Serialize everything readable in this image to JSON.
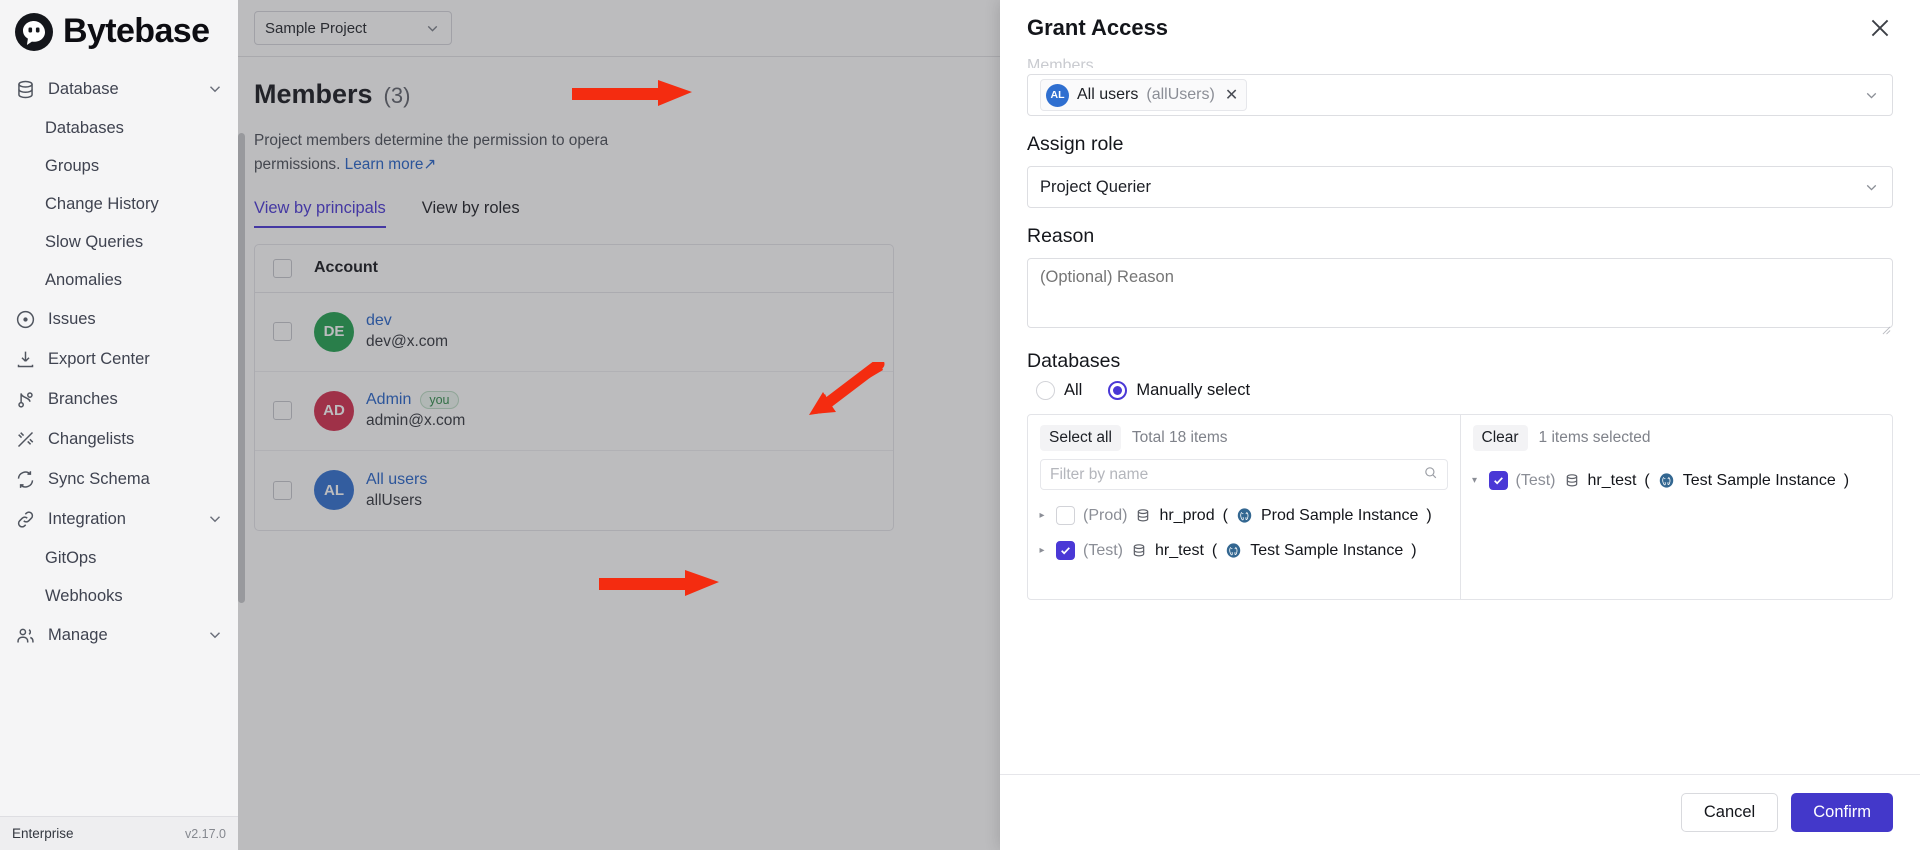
{
  "sidebar": {
    "brand": "Bytebase",
    "items": [
      {
        "label": "Database",
        "icon": "database-icon",
        "expandable": true
      },
      {
        "label": "Databases",
        "sub": true
      },
      {
        "label": "Groups",
        "sub": true
      },
      {
        "label": "Change History",
        "sub": true
      },
      {
        "label": "Slow Queries",
        "sub": true
      },
      {
        "label": "Anomalies",
        "sub": true
      },
      {
        "label": "Issues",
        "icon": "circle-dot-icon",
        "expandable": false
      },
      {
        "label": "Export Center",
        "icon": "download-icon",
        "expandable": false
      },
      {
        "label": "Branches",
        "icon": "branch-icon",
        "expandable": false
      },
      {
        "label": "Changelists",
        "icon": "changelist-icon",
        "expandable": false
      },
      {
        "label": "Sync Schema",
        "icon": "sync-icon",
        "expandable": false
      },
      {
        "label": "Integration",
        "icon": "link-icon",
        "expandable": true
      },
      {
        "label": "GitOps",
        "sub": true
      },
      {
        "label": "Webhooks",
        "sub": true
      },
      {
        "label": "Manage",
        "icon": "users-icon",
        "expandable": true
      }
    ],
    "footer": {
      "plan": "Enterprise",
      "version": "v2.17.0"
    }
  },
  "topbar": {
    "project": "Sample Project"
  },
  "page": {
    "title": "Members",
    "count": "(3)",
    "description": "Project members determine the permission to opera",
    "description2": "permissions.",
    "learn_more": "Learn more",
    "tabs": [
      {
        "label": "View by principals",
        "active": true
      },
      {
        "label": "View by roles",
        "active": false
      }
    ],
    "table": {
      "columns": [
        "Account"
      ],
      "rows": [
        {
          "initials": "DE",
          "color": "#21a150",
          "name": "dev",
          "email": "dev@x.com",
          "badge": ""
        },
        {
          "initials": "AD",
          "color": "#d32c4c",
          "name": "Admin",
          "email": "admin@x.com",
          "badge": "you"
        },
        {
          "initials": "AL",
          "color": "#2f6fd0",
          "name": "All users",
          "email": "allUsers",
          "badge": ""
        }
      ]
    }
  },
  "drawer": {
    "title": "Grant Access",
    "close_icon": "close-icon",
    "members_label_cut": "Members",
    "user_chip": {
      "initials": "AL",
      "name": "All users",
      "sub": "(allUsers)",
      "remove": "✕"
    },
    "assign_role": {
      "label": "Assign role",
      "value": "Project Querier"
    },
    "reason": {
      "label": "Reason",
      "placeholder": "(Optional) Reason",
      "value": ""
    },
    "databases": {
      "label": "Databases",
      "options": [
        {
          "label": "All",
          "selected": false
        },
        {
          "label": "Manually select",
          "selected": true
        }
      ],
      "left_panel": {
        "select_all": "Select all",
        "total": "Total 18 items",
        "filter_placeholder": "Filter by name",
        "search_icon": "search-icon",
        "rows": [
          {
            "env": "(Prod)",
            "name": "hr_prod",
            "instance": "Prod Sample Instance",
            "checked": false,
            "engine": "postgres"
          },
          {
            "env": "(Test)",
            "name": "hr_test",
            "instance": "Test Sample Instance",
            "checked": true,
            "engine": "postgres"
          }
        ]
      },
      "right_panel": {
        "clear": "Clear",
        "selected_count": "1 items selected",
        "rows": [
          {
            "env": "(Test)",
            "name": "hr_test",
            "instance": "Test Sample Instance",
            "checked": true,
            "engine": "postgres"
          }
        ]
      }
    },
    "footer": {
      "cancel": "Cancel",
      "confirm": "Confirm"
    }
  },
  "colors": {
    "accent": "#4a38d6",
    "confirm": "#4338ca",
    "link": "#2563c9",
    "arrow": "#f42c10"
  }
}
